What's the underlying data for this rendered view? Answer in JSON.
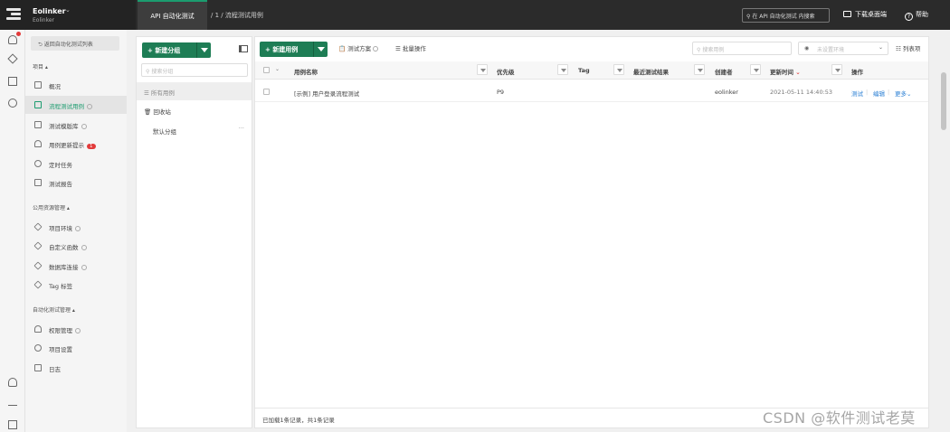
{
  "topbar": {
    "org_name": "Eolinker",
    "org_sub": "Eolinker",
    "app_tab": "API 自动化测试",
    "breadcrumb": "/ 1 / 流程测试用例",
    "search_placeholder": "在 API 自动化测试 内搜索",
    "download": "下载桌面端",
    "help": "帮助"
  },
  "sidebar": {
    "back": "返回自动化测试列表",
    "group_project": "项目",
    "group_shared": "公用资源管理",
    "group_admin": "自动化测试管理",
    "items": [
      {
        "label": "概况"
      },
      {
        "label": "流程测试用例"
      },
      {
        "label": "测试模版库"
      },
      {
        "label": "用例更新提示",
        "badge": "1"
      },
      {
        "label": "定时任务"
      },
      {
        "label": "测试报告"
      },
      {
        "label": "项目环境"
      },
      {
        "label": "自定义函数"
      },
      {
        "label": "数据库连接"
      },
      {
        "label": "Tag 标签"
      },
      {
        "label": "权限管理"
      },
      {
        "label": "项目设置"
      },
      {
        "label": "日志"
      }
    ]
  },
  "groups": {
    "new_group": "新建分组",
    "search_placeholder": "搜索分组",
    "all": "所有用例",
    "recycle": "回收站",
    "default": "默认分组",
    "more": "···"
  },
  "main": {
    "new_case": "新建用例",
    "test_plan": "测试方案",
    "batch": "批量操作",
    "search_placeholder": "搜索用例",
    "env_placeholder": "未设置环境",
    "columns_btn": "列表项",
    "columns": [
      "用例名称",
      "优先级",
      "Tag",
      "最近测试结果",
      "创建者",
      "更新时间",
      "操作"
    ],
    "row": {
      "name": "[示例] 用户登录流程测试",
      "priority": "P9",
      "tag": "",
      "result": "",
      "creator": "eolinker",
      "updated": "2021-05-11 14:40:53",
      "act_test": "测试",
      "act_edit": "编辑",
      "act_more": "更多"
    },
    "footer": "已加载1条记录，共1条记录"
  },
  "watermark": "CSDN @软件测试老莫",
  "colors": {
    "accent": "#1e7d55",
    "link": "#2a7fd4",
    "badge": "#e23a3a"
  }
}
